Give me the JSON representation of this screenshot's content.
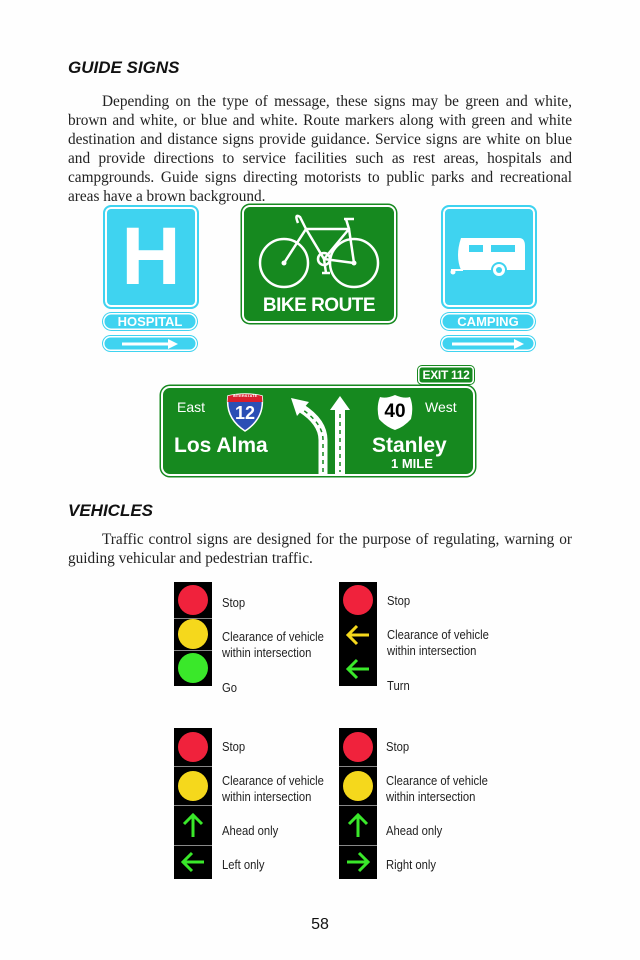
{
  "guide_signs": {
    "heading": "GUIDE SIGNS",
    "paragraph": "Depending on the type of message, these signs may be green and white, brown and white, or blue and white. Route markers along with green and white destination and distance signs provide guidance. Service signs are white on blue and provide directions to service facilities such as rest areas, hospitals and campgrounds. Guide signs directing motorists to public parks and recreational areas have a brown background.",
    "hospital_sign": {
      "symbol": "H",
      "label": "HOSPITAL",
      "arrow": "right"
    },
    "bike_sign": {
      "label": "BIKE ROUTE"
    },
    "camping_sign": {
      "label": "CAMPING",
      "arrow": "right"
    },
    "destination_sign": {
      "exit_tab": "EXIT 112",
      "left": {
        "direction": "East",
        "shield_top": "INTERSTATE",
        "route": "12",
        "city": "Los Alma"
      },
      "right": {
        "route": "40",
        "direction": "West",
        "city": "Stanley",
        "distance": "1 MILE"
      }
    },
    "colors": {
      "service_blue": "#3fd3f0",
      "guide_green": "#16891f"
    }
  },
  "vehicles": {
    "heading": "VEHICLES",
    "paragraph": "Traffic control signs are designed for the purpose of regulating, warning or guiding vehicular and pedestrian traffic.",
    "signals": [
      {
        "lamps": [
          {
            "type": "circle",
            "color": "#f0223c",
            "label": "Stop"
          },
          {
            "type": "circle",
            "color": "#f5d81c",
            "label": "Clearance of vehicle within intersection"
          },
          {
            "type": "circle",
            "color": "#3ae82a",
            "label": "Go"
          }
        ]
      },
      {
        "lamps": [
          {
            "type": "circle",
            "color": "#f0223c",
            "label": "Stop"
          },
          {
            "type": "arrow-left",
            "color": "#f5d81c",
            "label": "Clearance of vehicle within intersection"
          },
          {
            "type": "arrow-left",
            "color": "#3ae82a",
            "label": "Turn"
          }
        ]
      },
      {
        "lamps": [
          {
            "type": "circle",
            "color": "#f0223c",
            "label": "Stop"
          },
          {
            "type": "circle",
            "color": "#f5d81c",
            "label": "Clearance of vehicle within intersection"
          },
          {
            "type": "arrow-up",
            "color": "#3ae82a",
            "label": "Ahead only"
          },
          {
            "type": "arrow-left",
            "color": "#3ae82a",
            "label": "Left only"
          }
        ]
      },
      {
        "lamps": [
          {
            "type": "circle",
            "color": "#f0223c",
            "label": "Stop"
          },
          {
            "type": "circle",
            "color": "#f5d81c",
            "label": "Clearance of vehicle within intersection"
          },
          {
            "type": "arrow-up",
            "color": "#3ae82a",
            "label": "Ahead only"
          },
          {
            "type": "arrow-right",
            "color": "#3ae82a",
            "label": "Right only"
          }
        ]
      }
    ]
  },
  "page_number": "58"
}
